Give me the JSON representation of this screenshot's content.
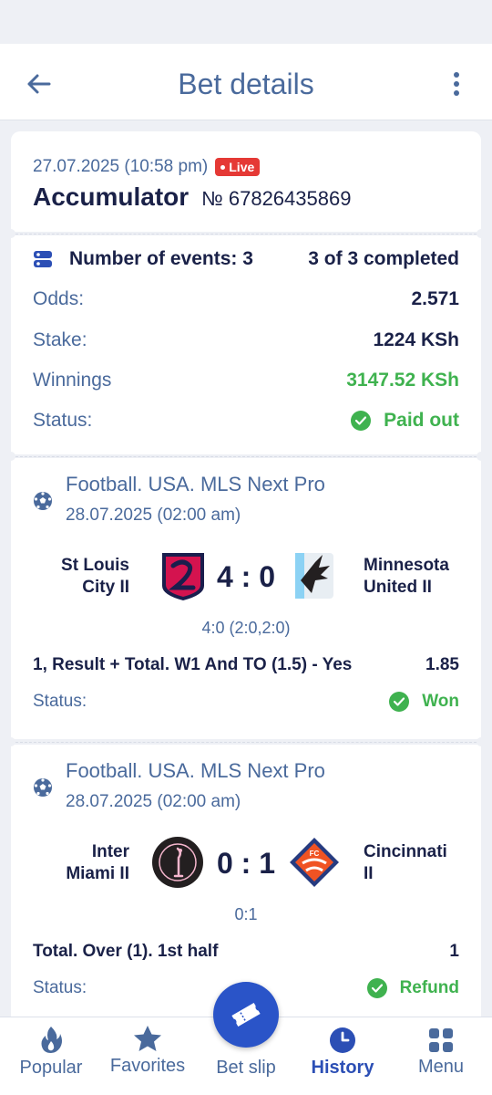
{
  "header": {
    "title": "Bet details",
    "back_icon": "arrow-left-icon",
    "more_icon": "more-vertical-icon"
  },
  "bet": {
    "date": "27.07.2025 (10:58 pm)",
    "live_label": "Live",
    "type": "Accumulator",
    "number": "№ 67826435869"
  },
  "summary": {
    "events_label": "Number of events: 3",
    "completed": "3 of 3 completed",
    "odds_label": "Odds:",
    "odds": "2.571",
    "stake_label": "Stake:",
    "stake": "1224 KSh",
    "winnings_label": "Winnings",
    "winnings": "3147.52 KSh",
    "status_label": "Status:",
    "status": "Paid out"
  },
  "events": [
    {
      "league": "Football. USA. MLS Next Pro",
      "kickoff": "28.07.2025 (02:00 am)",
      "home_line1": "St Louis",
      "home_line2": "City II",
      "away_line1": "Minnesota",
      "away_line2": "United II",
      "score": "4 : 0",
      "subscore": "4:0 (2:0,2:0)",
      "market": "1, Result + Total. W1 And TO (1.5) - Yes",
      "market_odds": "1.85",
      "status_label": "Status:",
      "status": "Won"
    },
    {
      "league": "Football. USA. MLS Next Pro",
      "kickoff": "28.07.2025 (02:00 am)",
      "home_line1": "Inter",
      "home_line2": "Miami II",
      "away_line1": "Cincinnati",
      "away_line2": "II",
      "score": "0 : 1",
      "subscore": "0:1",
      "market": "Total. Over (1). 1st half",
      "market_odds": "1",
      "status_label": "Status:",
      "status": "Refund"
    }
  ],
  "nav": {
    "popular": "Popular",
    "favorites": "Favorites",
    "betslip": "Bet slip",
    "history": "History",
    "menu": "Menu"
  },
  "colors": {
    "accent": "#2a54c8",
    "success": "#3fb24f",
    "live": "#e53935",
    "muted_text": "#4a6a9c"
  }
}
